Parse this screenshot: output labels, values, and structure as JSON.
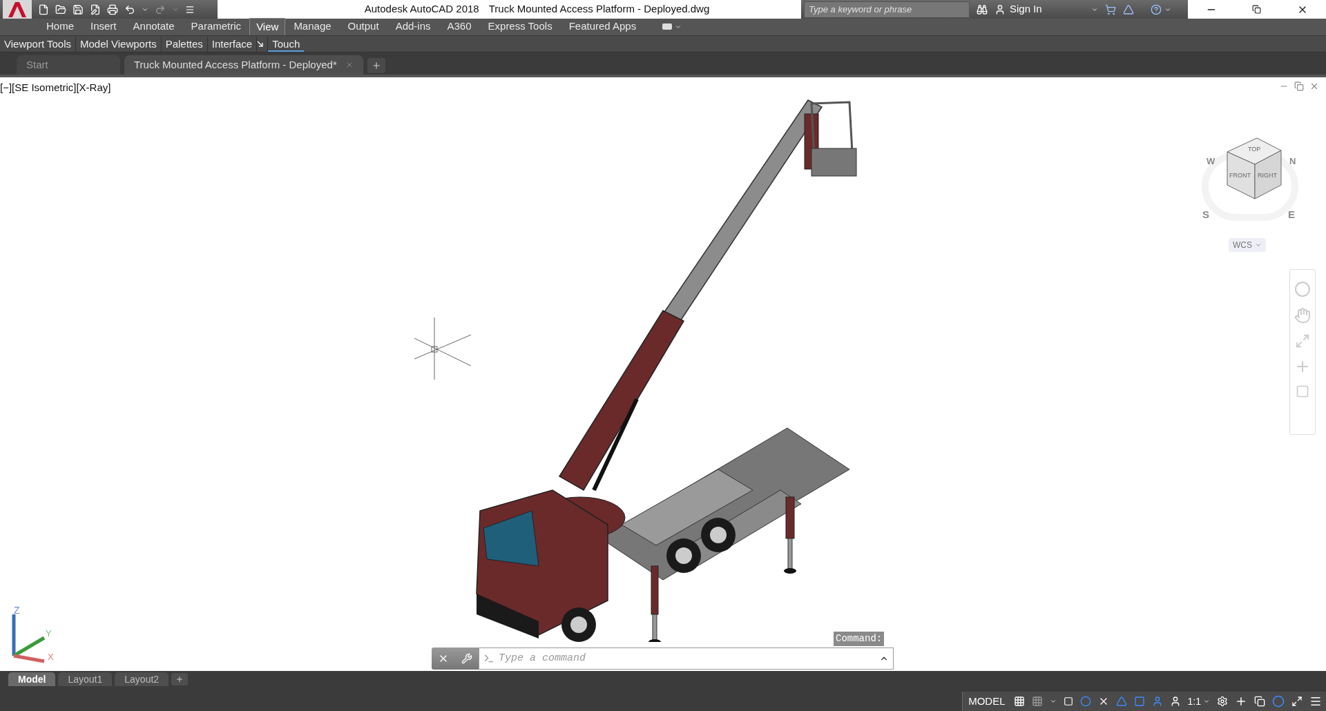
{
  "title_bar": {
    "app_name": "Autodesk AutoCAD 2018",
    "document": "Truck Mounted Access Platform - Deployed.dwg",
    "search": {
      "placeholder": "Type a keyword or phrase"
    },
    "sign_in": "Sign In"
  },
  "ribbon_tabs": [
    {
      "label": "Home",
      "selected": false
    },
    {
      "label": "Insert",
      "selected": false
    },
    {
      "label": "Annotate",
      "selected": false
    },
    {
      "label": "Parametric",
      "selected": false
    },
    {
      "label": "View",
      "selected": true
    },
    {
      "label": "Manage",
      "selected": false
    },
    {
      "label": "Output",
      "selected": false
    },
    {
      "label": "Add-ins",
      "selected": false
    },
    {
      "label": "A360",
      "selected": false
    },
    {
      "label": "Express Tools",
      "selected": false
    },
    {
      "label": "Featured Apps",
      "selected": false
    }
  ],
  "ribbon_panels": [
    {
      "label": "Viewport Tools",
      "launcher": false,
      "selected": false
    },
    {
      "label": "Model Viewports",
      "launcher": false,
      "selected": false
    },
    {
      "label": "Palettes",
      "launcher": false,
      "selected": false
    },
    {
      "label": "Interface",
      "launcher": true,
      "selected": false
    },
    {
      "label": "Touch",
      "launcher": false,
      "selected": true
    }
  ],
  "file_tabs": [
    {
      "label": "Start",
      "selected": false,
      "closable": false
    },
    {
      "label": "Truck Mounted Access Platform - Deployed*",
      "selected": true,
      "closable": true
    }
  ],
  "viewport": {
    "controls": "[−][SE Isometric][X-Ray]",
    "viewcube": {
      "top": "TOP",
      "front": "FRONT",
      "right": "RIGHT",
      "north": "N",
      "south": "S",
      "east": "E",
      "west": "W",
      "wcs": "WCS"
    },
    "ucs": {
      "z": "Z",
      "y": "Y",
      "x": "X"
    }
  },
  "command_line": {
    "history": "Command:",
    "placeholder": "Type a command"
  },
  "layout_tabs": [
    {
      "label": "Model",
      "selected": true
    },
    {
      "label": "Layout1",
      "selected": false
    },
    {
      "label": "Layout2",
      "selected": false
    }
  ],
  "status_bar": {
    "space": "MODEL",
    "scale": "1:1"
  }
}
